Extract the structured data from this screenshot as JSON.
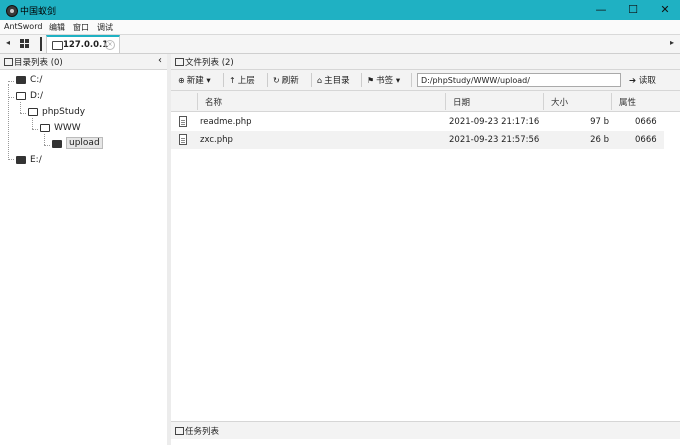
{
  "window": {
    "title": "中国蚁剑",
    "minimize": "—",
    "maximize": "☐",
    "close": "✕"
  },
  "menu": [
    "AntSword",
    "编辑",
    "窗口",
    "调试"
  ],
  "tabs": [
    {
      "label": "127.0.0.1",
      "close": "×"
    }
  ],
  "tab_arrows": {
    "left": "◂",
    "right": "▸"
  },
  "dir_panel": {
    "title": "目录列表 (0)",
    "collapse": "‹",
    "tree": [
      {
        "label": "C:/"
      },
      {
        "label": "D:/"
      },
      {
        "label": "phpStudy"
      },
      {
        "label": "WWW"
      },
      {
        "label": "upload"
      },
      {
        "label": "E:/"
      }
    ]
  },
  "file_panel": {
    "title": "文件列表 (2)",
    "toolbar": {
      "new": "新建",
      "up": "上层",
      "refresh": "刷新",
      "home": "主目录",
      "bookmark": "书签",
      "path": "D:/phpStudy/WWW/upload/",
      "read": "读取"
    },
    "columns": [
      "名称",
      "日期",
      "大小",
      "属性"
    ],
    "files": [
      {
        "name": "readme.php",
        "date": "2021-09-23 21:17:16",
        "size": "97 b",
        "attr": "0666"
      },
      {
        "name": "zxc.php",
        "date": "2021-09-23 21:57:56",
        "size": "26 b",
        "attr": "0666"
      }
    ]
  },
  "task_panel": {
    "title": "任务列表"
  }
}
